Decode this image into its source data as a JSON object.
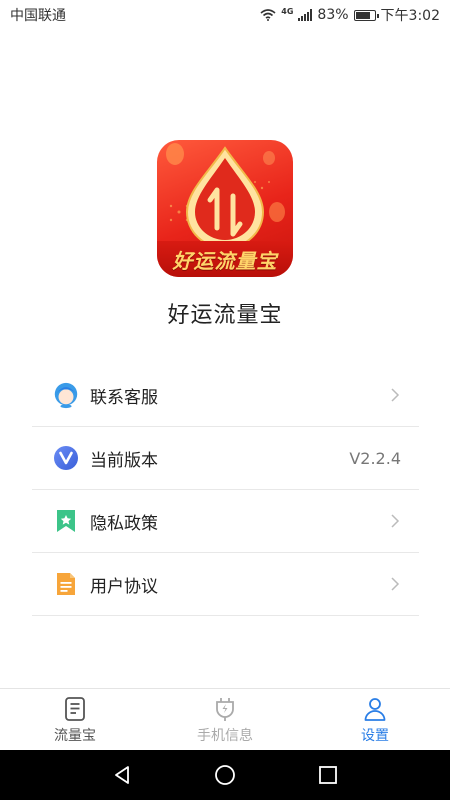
{
  "status_bar": {
    "carrier": "中国联通",
    "network_type": "4G",
    "battery_percent": "83%",
    "time": "下午3:02",
    "battery_level": 0.83
  },
  "app": {
    "logo_text": "好运流量宝",
    "name": "好运流量宝"
  },
  "menu": [
    {
      "label": "联系客服",
      "icon": "customer-service-icon",
      "value": "",
      "has_chevron": true
    },
    {
      "label": "当前版本",
      "icon": "version-v-icon",
      "value": "V2.2.4",
      "has_chevron": false
    },
    {
      "label": "隐私政策",
      "icon": "privacy-bookmark-icon",
      "value": "",
      "has_chevron": true
    },
    {
      "label": "用户协议",
      "icon": "document-icon",
      "value": "",
      "has_chevron": true
    }
  ],
  "tabs": [
    {
      "label": "流量宝",
      "icon": "doc-list-icon",
      "active": false
    },
    {
      "label": "手机信息",
      "icon": "plug-icon",
      "active": false
    },
    {
      "label": "设置",
      "icon": "user-icon",
      "active": true
    }
  ],
  "colors": {
    "active_tab": "#2a7ee6",
    "inactive_tab": "#555555",
    "disabled_tab": "#aaaaaa",
    "brand_red": "#e8241a"
  }
}
